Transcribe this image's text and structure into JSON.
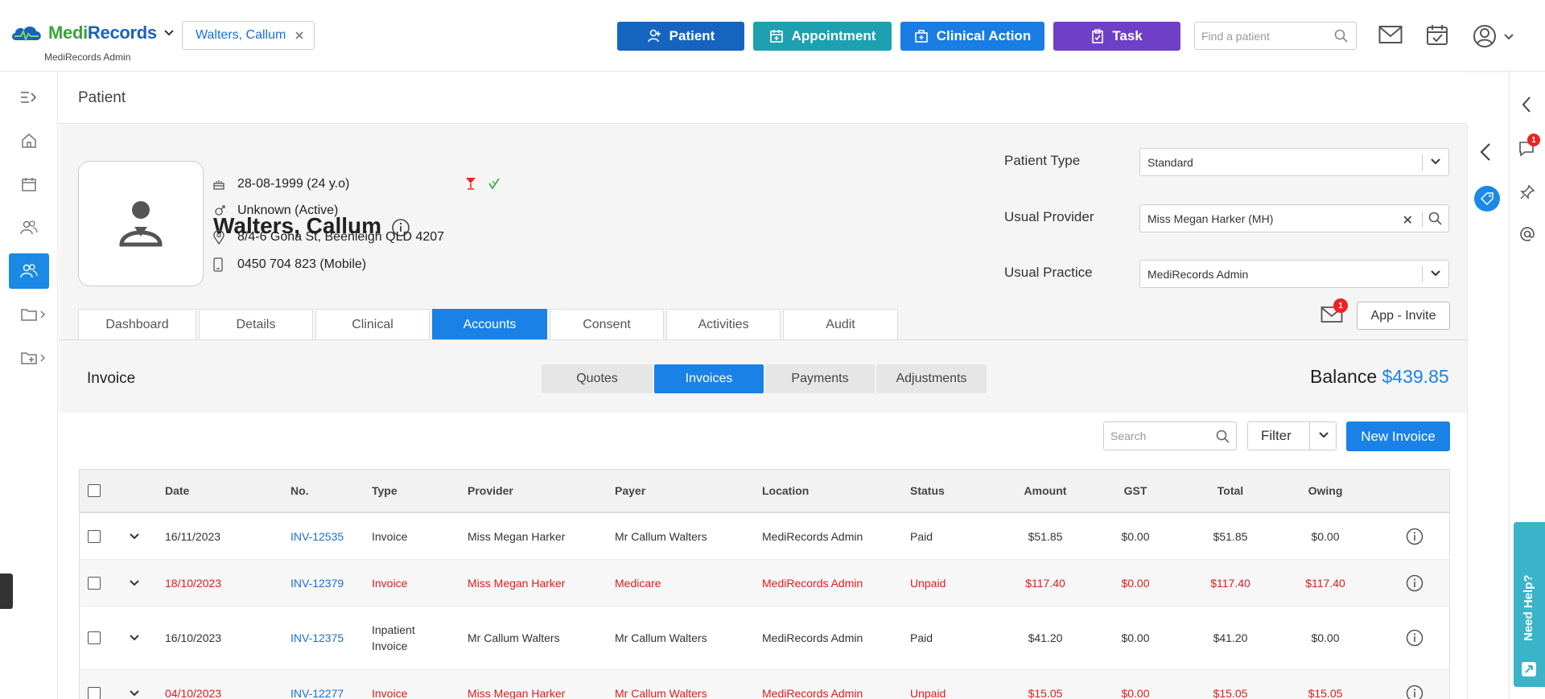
{
  "header": {
    "logo_medi": "Medi",
    "logo_records": "Records",
    "logo_sub": "MediRecords Admin",
    "patient_chip": "Walters, Callum",
    "btn_patient": "Patient",
    "btn_appointment": "Appointment",
    "btn_clinical": "Clinical Action",
    "btn_task": "Task",
    "find_placeholder": "Find a patient"
  },
  "page": {
    "title": "Patient"
  },
  "patient": {
    "name": "Walters, Callum",
    "dob": "28-08-1999 (24 y.o)",
    "gender": "Unknown (Active)",
    "address": "8/4-6 Gona St, Beenleigh QLD 4207",
    "phone": "0450 704 823 (Mobile)"
  },
  "fields": {
    "patient_type_label": "Patient Type",
    "patient_type_value": "Standard",
    "usual_provider_label": "Usual Provider",
    "usual_provider_value": "Miss Megan Harker (MH)",
    "usual_practice_label": "Usual Practice",
    "usual_practice_value": "MediRecords Admin"
  },
  "tabs": [
    "Dashboard",
    "Details",
    "Clinical",
    "Accounts",
    "Consent",
    "Activities",
    "Audit"
  ],
  "mail_badge": "1",
  "chat_badge": "1",
  "app_invite": "App - Invite",
  "invoice": {
    "title": "Invoice",
    "segments": [
      "Quotes",
      "Invoices",
      "Payments",
      "Adjustments"
    ],
    "balance_label": "Balance",
    "balance_value": "$439.85",
    "search_placeholder": "Search",
    "filter_label": "Filter",
    "new_invoice": "New Invoice"
  },
  "table": {
    "columns": [
      "Date",
      "No.",
      "Type",
      "Provider",
      "Payer",
      "Location",
      "Status",
      "Amount",
      "GST",
      "Total",
      "Owing"
    ],
    "rows": [
      {
        "date": "16/11/2023",
        "no": "INV-12535",
        "type": "Invoice",
        "provider": "Miss Megan Harker",
        "payer": "Mr Callum Walters",
        "location": "MediRecords Admin",
        "status": "Paid",
        "amount": "$51.85",
        "gst": "$0.00",
        "total": "$51.85",
        "owing": "$0.00"
      },
      {
        "date": "18/10/2023",
        "no": "INV-12379",
        "type": "Invoice",
        "provider": "Miss Megan Harker",
        "payer": "Medicare",
        "location": "MediRecords Admin",
        "status": "Unpaid",
        "amount": "$117.40",
        "gst": "$0.00",
        "total": "$117.40",
        "owing": "$117.40"
      },
      {
        "date": "16/10/2023",
        "no": "INV-12375",
        "type": "Inpatient Invoice",
        "provider": "Mr Callum Walters",
        "payer": "Mr Callum Walters",
        "location": "MediRecords Admin",
        "status": "Paid",
        "amount": "$41.20",
        "gst": "$0.00",
        "total": "$41.20",
        "owing": "$0.00"
      },
      {
        "date": "04/10/2023",
        "no": "INV-12277",
        "type": "Invoice",
        "provider": "Miss Megan Harker",
        "payer": "Mr Callum Walters",
        "location": "MediRecords Admin",
        "status": "Unpaid",
        "amount": "$15.05",
        "gst": "$0.00",
        "total": "$15.05",
        "owing": "$15.05"
      }
    ]
  },
  "need_help": "Need Help?",
  "colors": {
    "primary": "#1a82e6",
    "patient_btn": "#1565c0",
    "appointment_btn": "#1da1b0",
    "clinical_btn": "#1a7de3",
    "task_btn": "#6f3fc7",
    "unpaid": "#e01b1b"
  }
}
